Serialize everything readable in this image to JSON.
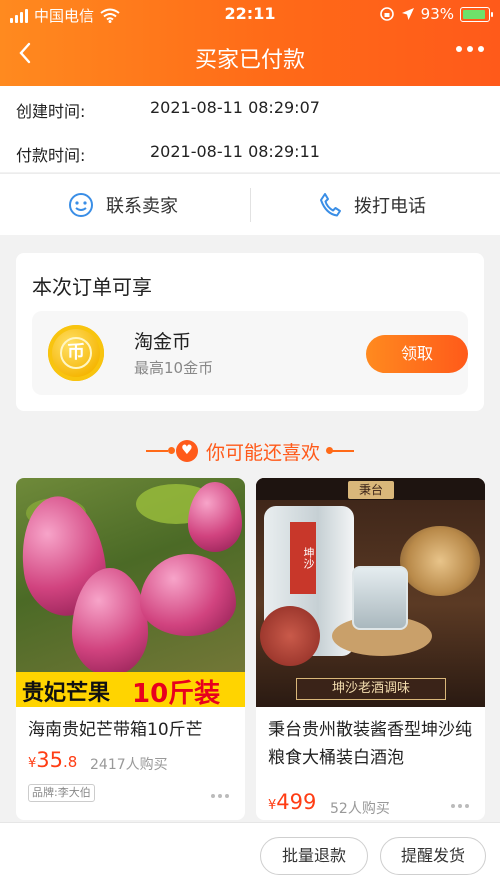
{
  "status_bar": {
    "carrier": "中国电信",
    "time": "22:11",
    "battery": "93%"
  },
  "nav": {
    "back_icon": "chevron-left-icon",
    "title": "买家已付款",
    "more_icon": "more-dots-icon"
  },
  "order_info": {
    "created_label": "创建时间:",
    "created_value": "2021-08-11 08:29:07",
    "paid_label": "付款时间:",
    "paid_value": "2021-08-11 08:29:11"
  },
  "contacts": {
    "seller_label": "联系卖家",
    "call_label": "拨打电话"
  },
  "coupon": {
    "heading": "本次订单可享",
    "coin_glyph": "币",
    "name": "淘金币",
    "subtitle": "最高10金币",
    "claim_label": "领取"
  },
  "recommend": {
    "title": "你可能还喜欢",
    "items": [
      {
        "banner_left": "贵妃芒果",
        "banner_right": "10斤装",
        "title": "海南贵妃芒带箱10斤芒",
        "price_symbol": "¥",
        "price_int": "35",
        "price_dec": ".8",
        "sold": "2417人购买",
        "brand": "品牌:李大伯"
      },
      {
        "badge": "秉台",
        "bottle_label": "坤沙",
        "caption": "坤沙老酒调味",
        "title": "秉台贵州散装酱香型坤沙纯粮食大桶装白酒泡",
        "price_symbol": "¥",
        "price_int": "499",
        "sold": "52人购买"
      }
    ]
  },
  "actions": {
    "refund_label": "批量退款",
    "remind_label": "提醒发货"
  },
  "colors": {
    "accent": "#ff5a1a",
    "gradient_start": "#ff8a1f",
    "price": "#ff3d14"
  }
}
